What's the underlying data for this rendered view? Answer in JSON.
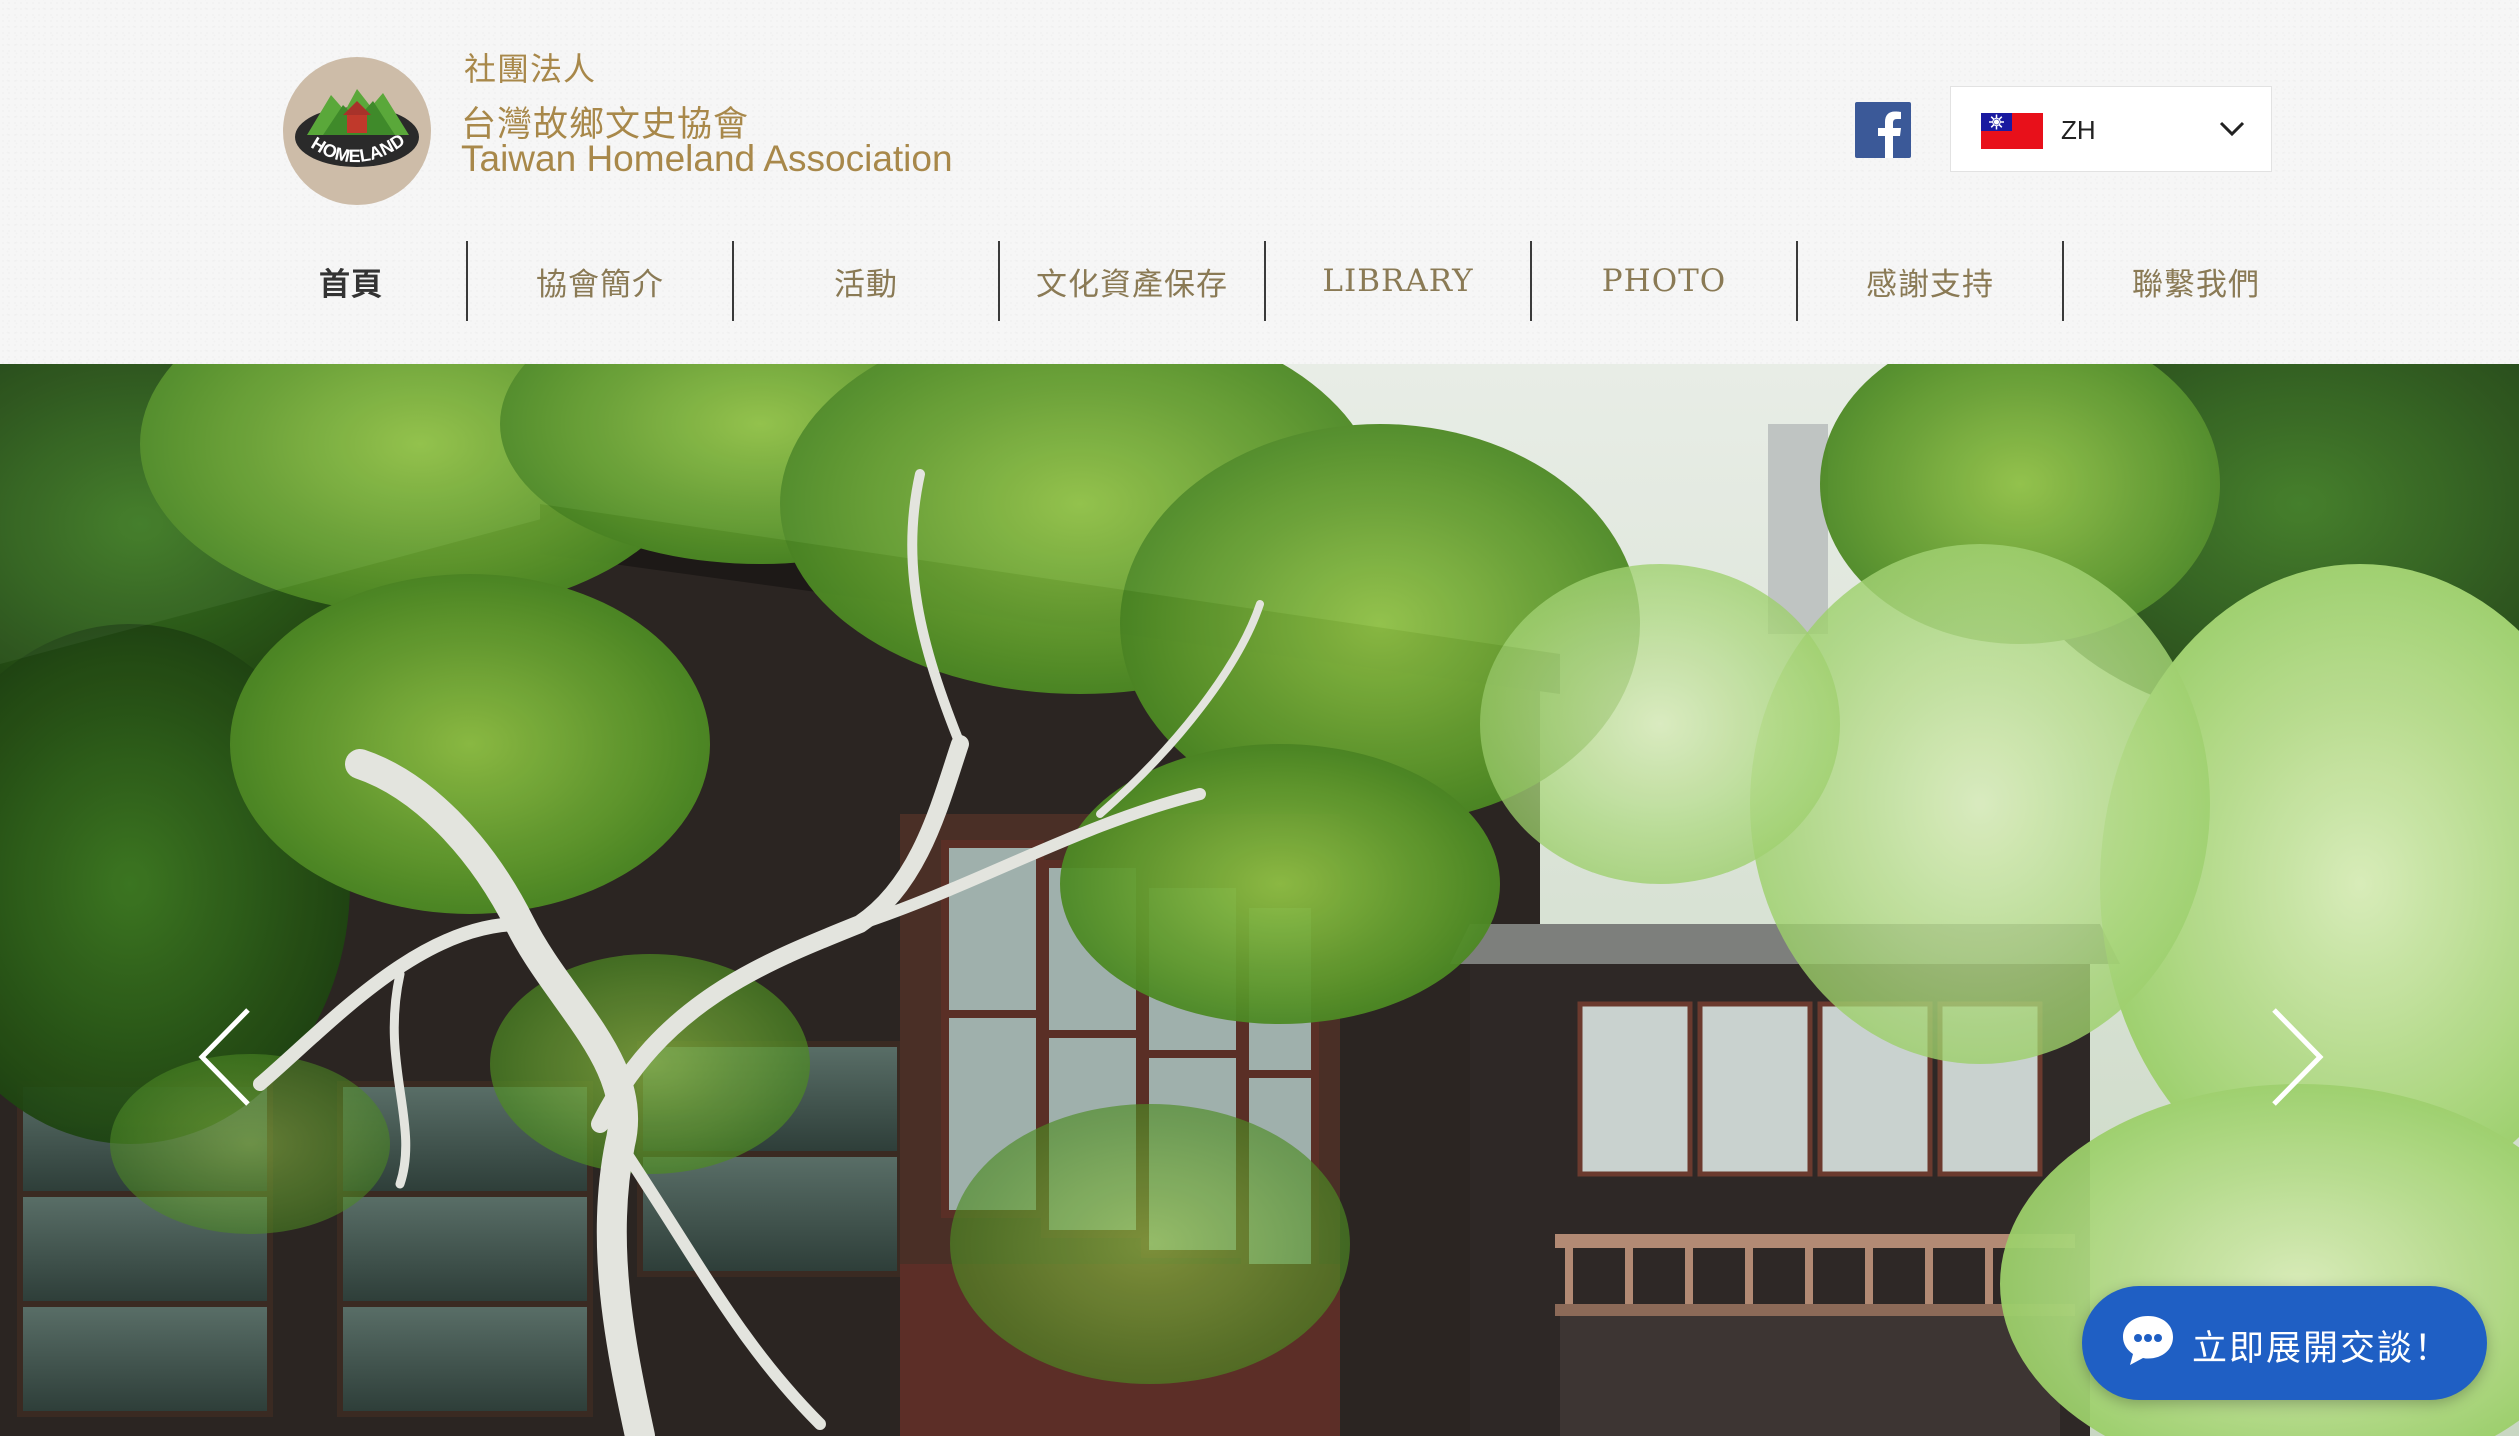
{
  "header": {
    "org_kind": "社團法人",
    "org_name_zh": "台灣故鄉文史協會",
    "org_name_en": "Taiwan Homeland Association",
    "logo_text": "HOMELAND",
    "social": {
      "icon": "facebook-icon",
      "color": "#3b5998"
    },
    "language": {
      "code": "ZH",
      "flag": "taiwan-flag-icon"
    }
  },
  "nav": {
    "items": [
      {
        "label": "首頁",
        "active": true
      },
      {
        "label": "協會簡介",
        "active": false
      },
      {
        "label": "活動",
        "active": false
      },
      {
        "label": "文化資產保存",
        "active": false
      },
      {
        "label": "LIBRARY",
        "active": false
      },
      {
        "label": "PHOTO",
        "active": false
      },
      {
        "label": "感謝支持",
        "active": false
      },
      {
        "label": "聯繫我們",
        "active": false
      }
    ]
  },
  "hero": {
    "slideshow": {
      "prev_icon": "chevron-left-icon",
      "next_icon": "chevron-right-icon"
    }
  },
  "chat": {
    "label": "立即展開交談！",
    "icon": "chat-bubble-icon",
    "color": "#1f5fc4"
  },
  "colors": {
    "accent": "#a8884a",
    "nav_text": "#8a7a55"
  }
}
